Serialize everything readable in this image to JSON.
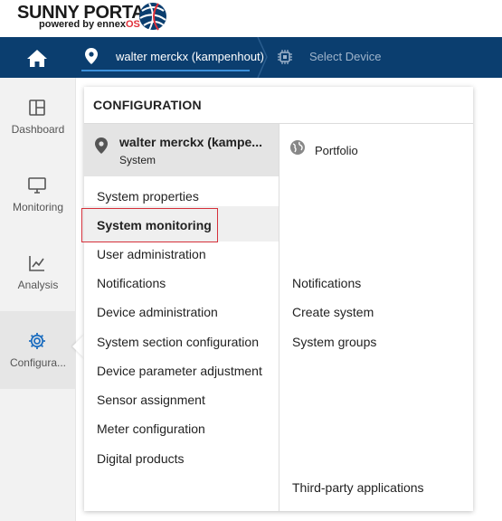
{
  "brand": {
    "name": "SUNNY PORTAL",
    "powered_by": "powered by ennex",
    "powered_by_hl": "OS"
  },
  "navbar": {
    "system_crumb": "walter merckx (kampenhout)",
    "device_crumb": "Select Device"
  },
  "sidebar": {
    "items": [
      {
        "label": "Dashboard",
        "icon": "dashboard-icon"
      },
      {
        "label": "Monitoring",
        "icon": "monitor-icon"
      },
      {
        "label": "Analysis",
        "icon": "chart-line-icon"
      },
      {
        "label": "Configura...",
        "icon": "gear-icon"
      }
    ]
  },
  "panel": {
    "title": "CONFIGURATION",
    "system": {
      "name": "walter merckx (kampe...",
      "type": "System"
    },
    "left_menu": [
      "System properties",
      "System monitoring",
      "User administration",
      "Notifications",
      "Device administration",
      "System section configuration",
      "Device parameter adjustment",
      "Sensor assignment",
      "Meter configuration",
      "Digital products"
    ],
    "selected_index": 1,
    "portfolio": "Portfolio",
    "right_menu": [
      "Notifications",
      "Create system",
      "System groups",
      "Third-party applications"
    ]
  },
  "colors": {
    "navbar": "#0b3e6f",
    "accent": "#3b8fd9",
    "selected_border": "#d6303a",
    "brand_red": "#e0303a"
  }
}
